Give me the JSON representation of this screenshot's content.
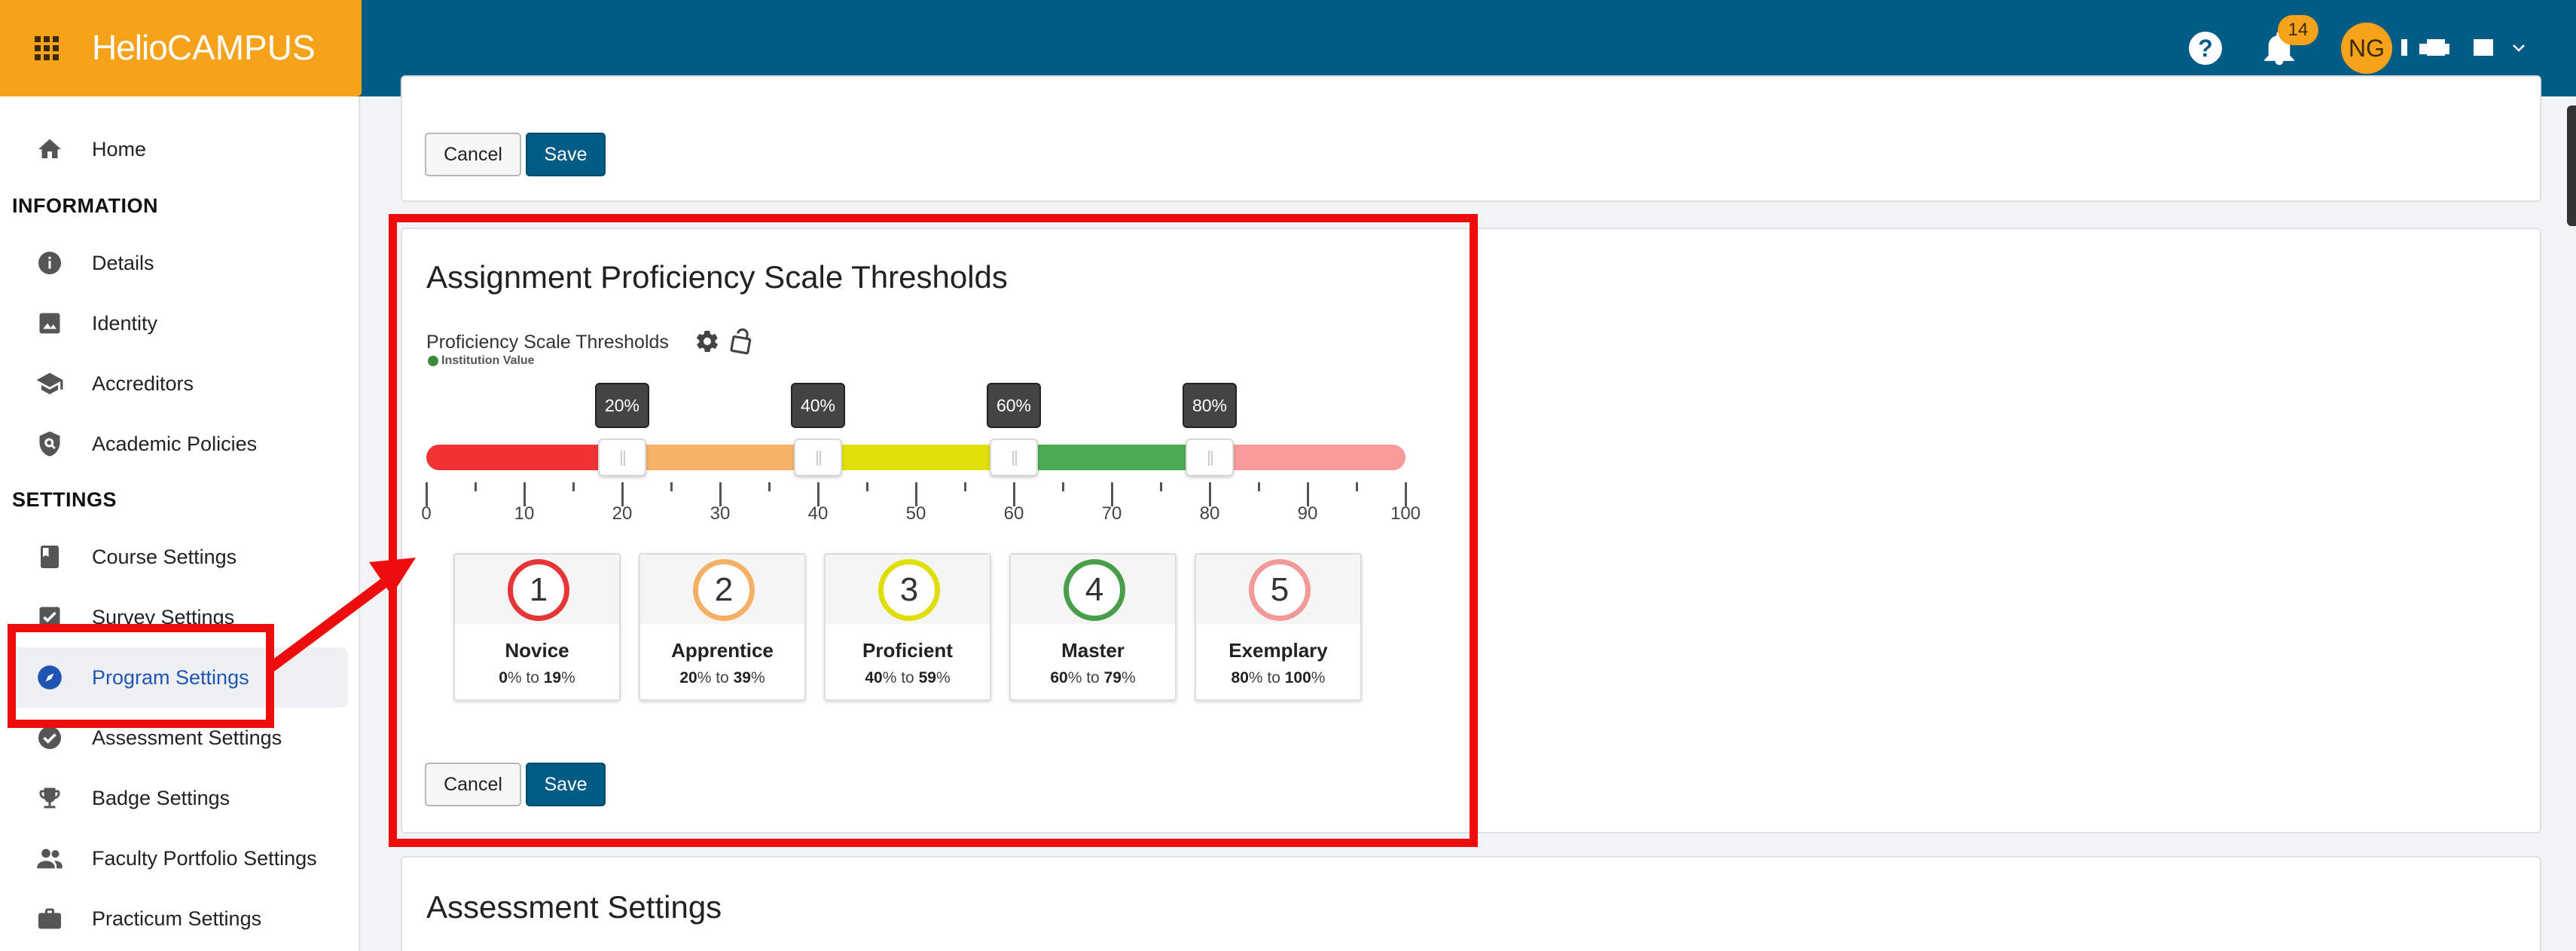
{
  "app": {
    "logo_main": "Helio",
    "logo_sub": "CAMPUS",
    "notifications_count": "14",
    "user_initials": "NG"
  },
  "sidebar": {
    "home": "Home",
    "section_information": "INFORMATION",
    "details": "Details",
    "identity": "Identity",
    "accreditors": "Accreditors",
    "academic_policies": "Academic Policies",
    "section_settings": "SETTINGS",
    "course_settings": "Course Settings",
    "survey_settings": "Survey Settings",
    "program_settings": "Program Settings",
    "assessment_settings": "Assessment Settings",
    "badge_settings": "Badge Settings",
    "faculty_portfolio_settings": "Faculty Portfolio Settings",
    "practicum_settings": "Practicum Settings"
  },
  "top_card": {
    "cancel_label": "Cancel",
    "save_label": "Save"
  },
  "proficiency_card": {
    "title": "Assignment Proficiency Scale Thresholds",
    "field_label": "Proficiency Scale Thresholds",
    "source_label": "Institution Value",
    "thresholds": [
      20,
      40,
      60,
      80
    ],
    "threshold_labels": [
      "20%",
      "40%",
      "60%",
      "80%"
    ],
    "scale_ticks": [
      "0",
      "10",
      "20",
      "30",
      "40",
      "50",
      "60",
      "70",
      "80",
      "90",
      "100"
    ],
    "segment_colors": [
      "#f03434",
      "#f7b26a",
      "#e0e005",
      "#4caa50",
      "#f79b9b"
    ],
    "levels": [
      {
        "number": "1",
        "name": "Novice",
        "from": "0",
        "to": "19",
        "color": "#e53535"
      },
      {
        "number": "2",
        "name": "Apprentice",
        "from": "20",
        "to": "39",
        "color": "#f4b066"
      },
      {
        "number": "3",
        "name": "Proficient",
        "from": "40",
        "to": "59",
        "color": "#dede00"
      },
      {
        "number": "4",
        "name": "Master",
        "from": "60",
        "to": "79",
        "color": "#4a9e4a"
      },
      {
        "number": "5",
        "name": "Exemplary",
        "from": "80",
        "to": "100",
        "color": "#f29a9a"
      }
    ],
    "range_joiner": "to",
    "percent_sign": "%",
    "cancel_label": "Cancel",
    "save_label": "Save"
  },
  "assessment_card": {
    "title": "Assessment Settings"
  }
}
